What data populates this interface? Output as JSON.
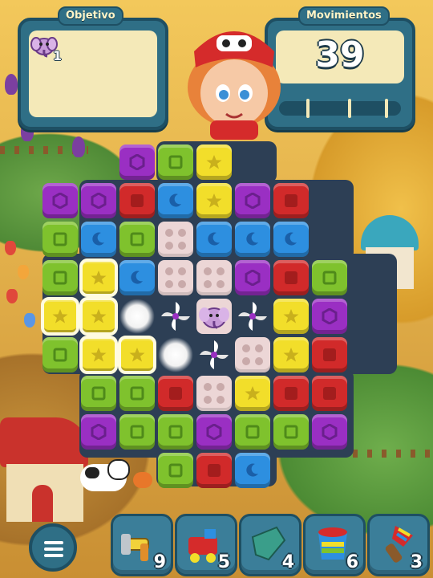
{
  "hud": {
    "objective_label": "Objetivo",
    "moves_label": "Movimientos",
    "moves_value": "39",
    "goal_count": "1",
    "goal_icon": "elephant-icon"
  },
  "tools": [
    {
      "name": "hammer-tool",
      "icon": "hammer-icon",
      "count": "9"
    },
    {
      "name": "train-tool",
      "icon": "train-icon",
      "count": "5"
    },
    {
      "name": "glove-tool",
      "icon": "glove-icon",
      "count": "4"
    },
    {
      "name": "paint-bucket-tool",
      "icon": "paint-bucket-icon",
      "count": "6"
    },
    {
      "name": "brush-tool",
      "icon": "brush-icon",
      "count": "3"
    }
  ],
  "menu": {
    "icon": "menu-icon"
  },
  "colors": {
    "yellow": "#f2de2a",
    "green": "#7fc22d",
    "purple": "#9a2fc3",
    "blue": "#2d8fe0",
    "red": "#d12a2a",
    "toy_block": "#ecd6d6"
  },
  "board": {
    "rows": [
      [
        "",
        "",
        "purple",
        "green",
        "yellow",
        "",
        "",
        ""
      ],
      [
        "purple",
        "purple",
        "red",
        "blue",
        "yellow",
        "purple",
        "red",
        ""
      ],
      [
        "green",
        "blue",
        "green",
        "pink",
        "blue",
        "blue",
        "blue",
        ""
      ],
      [
        "green",
        "yellow",
        "blue",
        "pink",
        "pink",
        "purple",
        "red",
        "green"
      ],
      [
        "yellow",
        "yellow",
        "white",
        "pinwheel",
        "elephant",
        "pinwheel",
        "yellow",
        "purple"
      ],
      [
        "green",
        "yellow",
        "yellow",
        "white",
        "pinwheel",
        "pink",
        "yellow",
        "red"
      ],
      [
        "",
        "green",
        "green",
        "red",
        "pink",
        "yellow",
        "red",
        "red"
      ],
      [
        "",
        "purple",
        "green",
        "green",
        "purple",
        "green",
        "green",
        "purple"
      ],
      [
        "",
        "",
        "",
        "green",
        "red",
        "blue",
        "",
        ""
      ]
    ]
  }
}
